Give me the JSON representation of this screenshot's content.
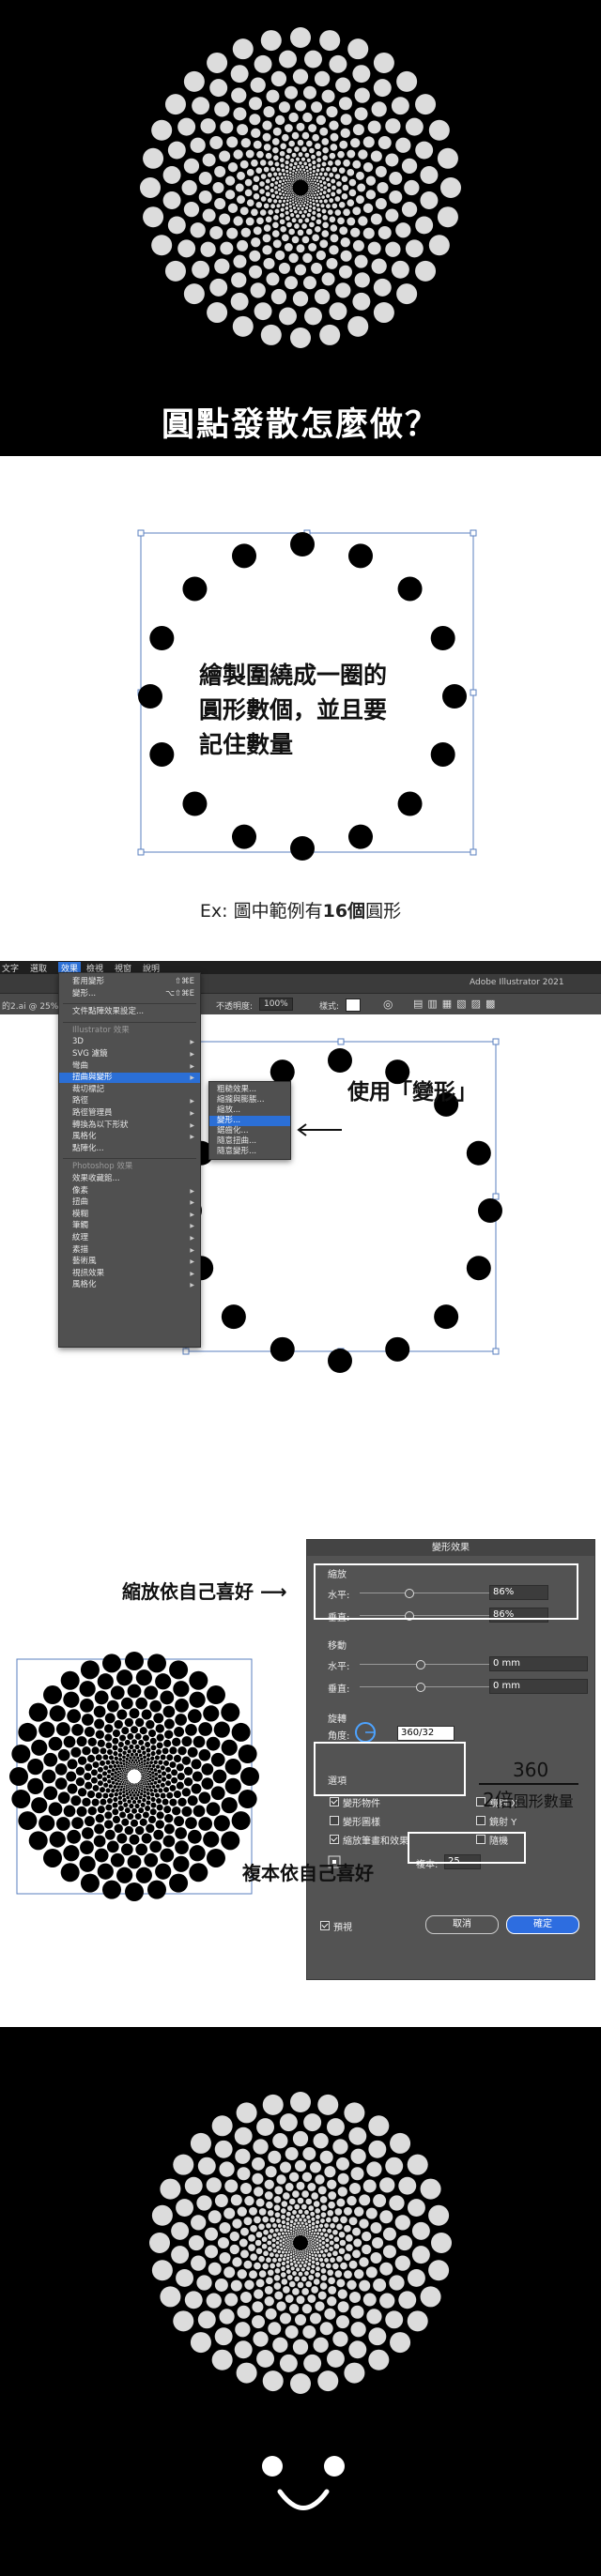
{
  "hero": {
    "title": "圓點發散怎麼做？"
  },
  "step1": {
    "instruction_lines": [
      "繪製圍繞成一圈的",
      "圓形數個，並且要",
      "記住數量"
    ],
    "caption_prefix": "Ex: 圖中範例有",
    "caption_count": "16個",
    "caption_suffix": "圓形",
    "dot_count": 16
  },
  "illustrator": {
    "app_title": "Adobe Illustrator 2021",
    "menubar": [
      "文字",
      "選取",
      "效果",
      "檢視",
      "視窗",
      "說明"
    ],
    "active_menu": "效果",
    "control_bar": {
      "file_tab": "的2.ai @ 25% (",
      "opacity_label": "不透明度:",
      "opacity_value": "100%",
      "style_label": "樣式:"
    },
    "effect_menu": [
      {
        "label": "套用變形",
        "shortcut": "⇧⌘E",
        "type": "item"
      },
      {
        "label": "變形...",
        "shortcut": "⌥⇧⌘E",
        "type": "item"
      },
      {
        "type": "sep"
      },
      {
        "label": "文件點陣效果設定...",
        "type": "item"
      },
      {
        "type": "sep"
      },
      {
        "label": "Illustrator 效果",
        "type": "header"
      },
      {
        "label": "3D",
        "type": "sub"
      },
      {
        "label": "SVG 濾鏡",
        "type": "sub"
      },
      {
        "label": "彎曲",
        "type": "sub"
      },
      {
        "label": "扭曲與變形",
        "type": "sub",
        "selected": true
      },
      {
        "label": "裁切標記",
        "type": "item"
      },
      {
        "label": "路徑",
        "type": "sub"
      },
      {
        "label": "路徑管理員",
        "type": "sub"
      },
      {
        "label": "轉換為以下形狀",
        "type": "sub"
      },
      {
        "label": "風格化",
        "type": "sub"
      },
      {
        "label": "點陣化...",
        "type": "item"
      },
      {
        "type": "sep"
      },
      {
        "label": "Photoshop 效果",
        "type": "header"
      },
      {
        "label": "效果收藏館...",
        "type": "item"
      },
      {
        "label": "像素",
        "type": "sub"
      },
      {
        "label": "扭曲",
        "type": "sub"
      },
      {
        "label": "模糊",
        "type": "sub"
      },
      {
        "label": "筆觸",
        "type": "sub"
      },
      {
        "label": "紋理",
        "type": "sub"
      },
      {
        "label": "素描",
        "type": "sub"
      },
      {
        "label": "藝術風",
        "type": "sub"
      },
      {
        "label": "視訊效果",
        "type": "sub"
      },
      {
        "label": "風格化",
        "type": "sub"
      }
    ],
    "distort_submenu": [
      {
        "label": "粗糙效果...",
        "selected": false
      },
      {
        "label": "縮攏與膨脹...",
        "selected": false
      },
      {
        "label": "縮放...",
        "selected": false
      },
      {
        "label": "變形...",
        "selected": true
      },
      {
        "label": "鋸齒化...",
        "selected": false
      },
      {
        "label": "隨意扭曲...",
        "selected": false
      },
      {
        "label": "隨意變形...",
        "selected": false
      }
    ],
    "use_transform_note": "使用「變形」"
  },
  "transform_dialog": {
    "title": "變形效果",
    "scale": {
      "section": "縮放",
      "h_label": "水平:",
      "h_value": "86%",
      "v_label": "垂直:",
      "v_value": "86%"
    },
    "move": {
      "section": "移動",
      "h_label": "水平:",
      "h_value": "0 mm",
      "v_label": "垂直:",
      "v_value": "0 mm"
    },
    "rotate": {
      "section": "旋轉",
      "angle_label": "角度:",
      "angle_value": "360/32"
    },
    "options": {
      "section": "選項",
      "items": [
        {
          "label": "變形物件",
          "checked": true
        },
        {
          "label": "鏡射 X",
          "checked": false
        },
        {
          "label": "變形圖樣",
          "checked": false
        },
        {
          "label": "鏡射 Y",
          "checked": false
        },
        {
          "label": "縮放筆畫和效果",
          "checked": true
        },
        {
          "label": "隨機",
          "checked": false
        }
      ]
    },
    "copies": {
      "label": "複本:",
      "value": "25"
    },
    "preview": {
      "label": "預視",
      "checked": true
    },
    "cancel_label": "取消",
    "ok_label": "確定",
    "notes": {
      "scale_note": "縮放依自己喜好",
      "copies_note": "複本依自己喜好",
      "fraction_top": "360",
      "fraction_bottom": "2倍",
      "fraction_suffix": "圓形數量"
    }
  },
  "colors": {
    "dark_bg": "#000000",
    "dot_light": "#dcdcdc",
    "dot_dark": "#000000",
    "selection_blue": "#2b6fd6",
    "ok_button": "#2d6de0"
  }
}
